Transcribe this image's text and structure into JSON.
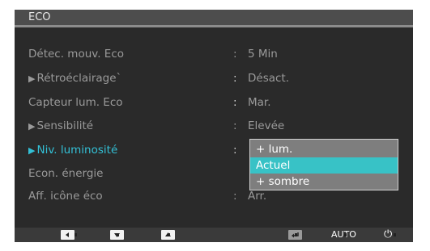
{
  "osd": {
    "title": "ECO",
    "rows": [
      {
        "label": "Détec. mouv. Eco",
        "value": "5 Min",
        "arrow": ""
      },
      {
        "label": "Rétroéclairage`",
        "value": "Désact.",
        "arrow": "▶"
      },
      {
        "label": "Capteur lum. Eco",
        "value": "Mar.",
        "arrow": ""
      },
      {
        "label": "Sensibilité",
        "value": "Elevée",
        "arrow": "▶"
      },
      {
        "label": "Niv. luminosité",
        "value": "",
        "arrow": "▶"
      },
      {
        "label": "Econ. énergie",
        "value": "",
        "arrow": ""
      },
      {
        "label": "Aff. icône éco",
        "value": "Arr.",
        "arrow": ""
      }
    ],
    "colon": ":",
    "dropdown": {
      "options": [
        "+ lum.",
        "Actuel",
        "+ sombre"
      ],
      "selected": "Actuel"
    }
  },
  "buttons": {
    "auto_label": "AUTO",
    "power_glyph": "⏻"
  },
  "colors": {
    "active": "#33c0d6",
    "selected_bg": "#38c2c6",
    "panel_bg": "#2a2a2a",
    "title_bg": "#4d4d4d"
  },
  "icons": [
    "left-arrow-icon",
    "down-arrow-icon",
    "up-arrow-icon",
    "enter-icon",
    "power-icon"
  ]
}
